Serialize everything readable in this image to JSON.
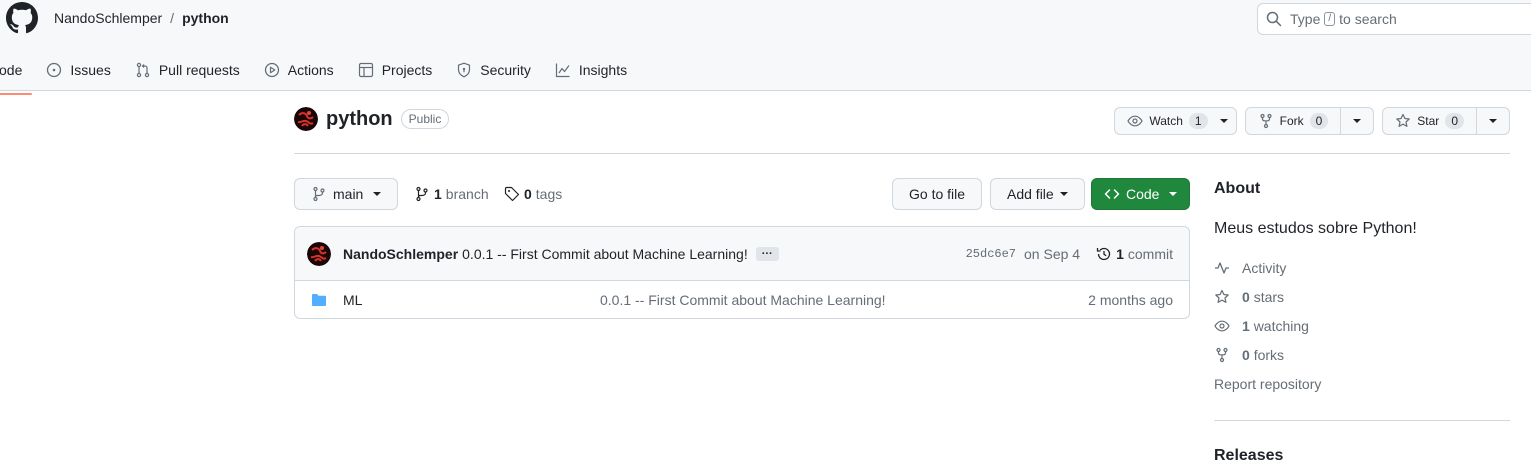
{
  "header": {
    "owner": "NandoSchlemper",
    "separator": "/",
    "repo": "python",
    "search": {
      "prefix": "Type",
      "key": "/",
      "suffix": "to search"
    }
  },
  "nav": {
    "tabs": [
      {
        "label": "ode",
        "icon": "code-icon"
      },
      {
        "label": "Issues",
        "icon": "issue-icon"
      },
      {
        "label": "Pull requests",
        "icon": "pull-request-icon"
      },
      {
        "label": "Actions",
        "icon": "play-icon"
      },
      {
        "label": "Projects",
        "icon": "table-icon"
      },
      {
        "label": "Security",
        "icon": "shield-icon"
      },
      {
        "label": "Insights",
        "icon": "graph-icon"
      }
    ]
  },
  "repo": {
    "name": "python",
    "visibility": "Public",
    "watch": {
      "label": "Watch",
      "count": "1"
    },
    "fork": {
      "label": "Fork",
      "count": "0"
    },
    "star": {
      "label": "Star",
      "count": "0"
    }
  },
  "filenav": {
    "branch": "main",
    "branch_count": "1",
    "branch_label": "branch",
    "tag_count": "0",
    "tag_label": "tags",
    "go_to_file": "Go to file",
    "add_file": "Add file",
    "code": "Code"
  },
  "commit": {
    "author": "NandoSchlemper",
    "message": "0.0.1 -- First Commit about Machine Learning!",
    "ellipsis": "···",
    "sha": "25dc6e7",
    "date": "on Sep 4",
    "count": "1",
    "count_label": "commit"
  },
  "files": [
    {
      "name": "ML",
      "message": "0.0.1 -- First Commit about Machine Learning!",
      "age": "2 months ago",
      "icon": "folder-icon"
    }
  ],
  "about": {
    "heading": "About",
    "description": "Meus estudos sobre Python!",
    "activity": "Activity",
    "stars_count": "0",
    "stars_label": "stars",
    "watching_count": "1",
    "watching_label": "watching",
    "forks_count": "0",
    "forks_label": "forks",
    "report": "Report repository",
    "releases": "Releases"
  },
  "colors": {
    "accent_green": "#1f883d",
    "tab_underline": "#fd8c73",
    "folder": "#54aeff"
  }
}
